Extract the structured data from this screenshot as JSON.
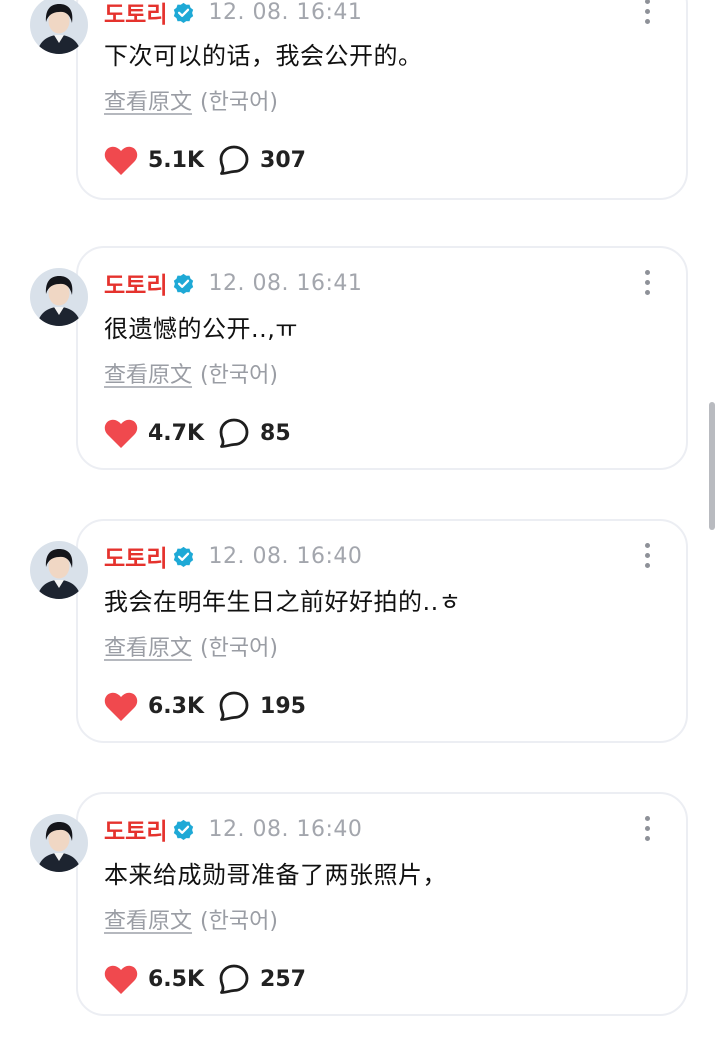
{
  "posts": [
    {
      "username": "도토리",
      "timestamp": "12. 08. 16:41",
      "message": "下次可以的话，我会公开的。",
      "translate_label": "查看原文",
      "original_language": "(한국어)",
      "likes": "5.1K",
      "comments": "307"
    },
    {
      "username": "도토리",
      "timestamp": "12. 08. 16:41",
      "message": "很遗憾的公开..,ㅠ",
      "translate_label": "查看原文",
      "original_language": "(한국어)",
      "likes": "4.7K",
      "comments": "85"
    },
    {
      "username": "도토리",
      "timestamp": "12. 08. 16:40",
      "message": "我会在明年生日之前好好拍的..ㅎ",
      "translate_label": "查看原文",
      "original_language": "(한국어)",
      "likes": "6.3K",
      "comments": "195"
    },
    {
      "username": "도토리",
      "timestamp": "12. 08. 16:40",
      "message": "本来给成勋哥准备了两张照片，",
      "translate_label": "查看原文",
      "original_language": "(한국어)",
      "likes": "6.5K",
      "comments": "257"
    }
  ],
  "icons": {
    "verified": "verified-badge-icon",
    "like": "heart-icon",
    "comment": "speech-bubble-icon",
    "more": "more-vertical-icon"
  },
  "colors": {
    "username": "#e5322d",
    "verified": "#1ea9d6",
    "heart": "#f0494e",
    "timestamp": "#a3a6ad",
    "card_border": "#eceef3"
  }
}
